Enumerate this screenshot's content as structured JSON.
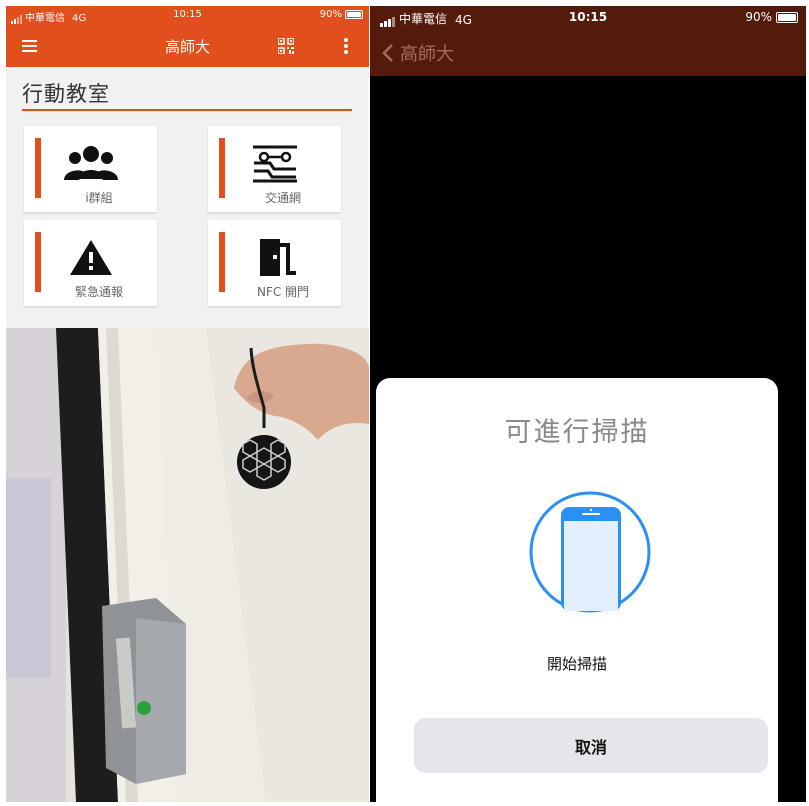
{
  "left": {
    "status_bar": {
      "carrier": "中華電信",
      "network": "4G",
      "time": "10:15",
      "battery": "90%"
    },
    "app_bar": {
      "title": "高師大",
      "icons": [
        "menu-icon",
        "qr-code-icon",
        "more-vert-icon"
      ]
    },
    "section": {
      "title": "行動教室"
    },
    "tiles": [
      {
        "label": "i群組",
        "icon": "group-icon"
      },
      {
        "label": "交通網",
        "icon": "transit-network-icon"
      },
      {
        "label": "緊急通報",
        "icon": "warning-icon"
      },
      {
        "label": "NFC 開門",
        "icon": "door-icon"
      }
    ],
    "colors": {
      "accent": "#e04f1c"
    }
  },
  "right": {
    "status_bar": {
      "carrier": "中華電信",
      "network": "4G",
      "time": "10:15",
      "battery": "90%"
    },
    "app_bar": {
      "back_label": "高師大"
    },
    "nfc_sheet": {
      "title": "可進行掃描",
      "icon": "phone-scan-icon",
      "message": "開始掃描",
      "cancel_label": "取消"
    },
    "colors": {
      "header": "#541a0b",
      "scan_icon": "#2b8ff3"
    }
  }
}
